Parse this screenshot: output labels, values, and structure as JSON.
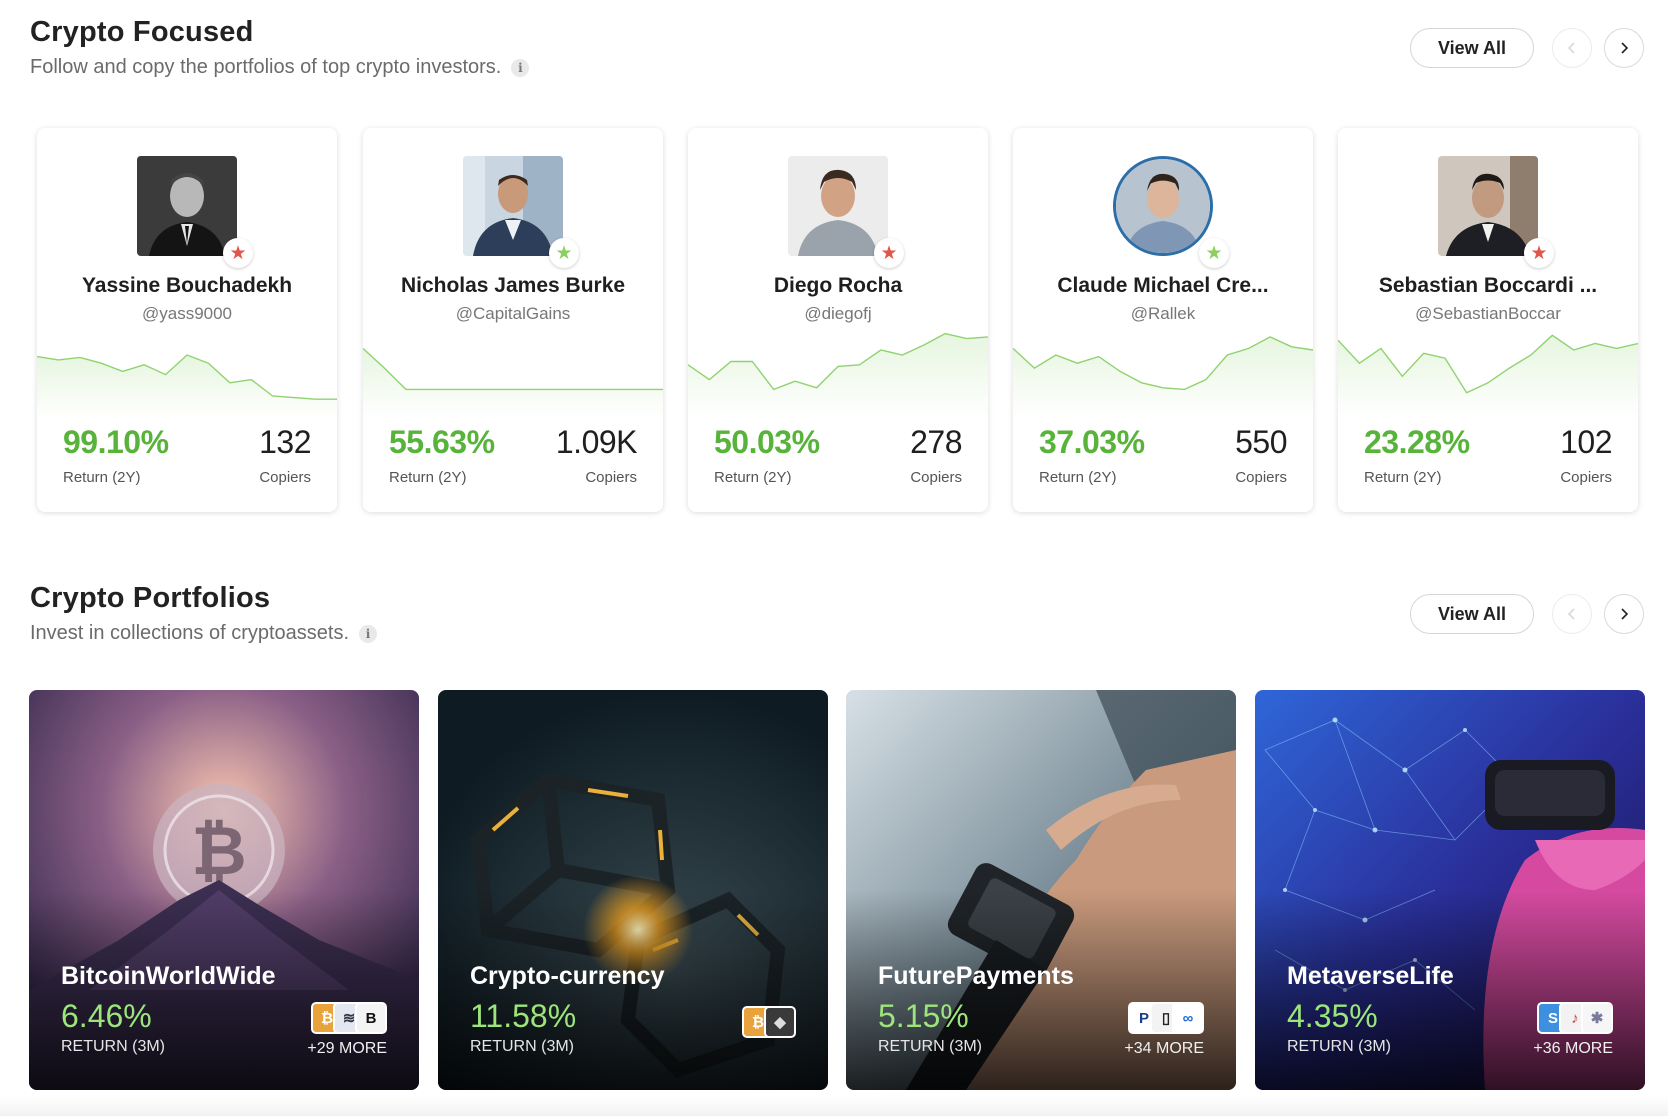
{
  "focused": {
    "title": "Crypto Focused",
    "subtitle": "Follow and copy the portfolios of top crypto investors.",
    "view_all": "View All",
    "investors": [
      {
        "name": "Yassine Bouchadekh",
        "handle": "@yass9000",
        "return": "99.10%",
        "return_label": "Return (2Y)",
        "copiers": "132",
        "copiers_label": "Copiers",
        "star": "red",
        "spark": [
          30,
          34,
          31,
          38,
          48,
          40,
          52,
          28,
          38,
          62,
          58,
          78,
          80,
          82,
          82
        ]
      },
      {
        "name": "Nicholas James Burke",
        "handle": "@CapitalGains",
        "return": "55.63%",
        "return_label": "Return (2Y)",
        "copiers": "1.09K",
        "copiers_label": "Copiers",
        "star": "green",
        "spark": [
          20,
          44,
          70,
          70,
          70,
          70,
          70,
          70,
          70,
          70,
          70,
          70,
          70,
          70,
          70
        ]
      },
      {
        "name": "Diego Rocha",
        "handle": "@diegofj",
        "return": "50.03%",
        "return_label": "Return (2Y)",
        "copiers": "278",
        "copiers_label": "Copiers",
        "star": "red",
        "spark": [
          40,
          58,
          36,
          36,
          70,
          60,
          68,
          42,
          40,
          22,
          28,
          16,
          2,
          8,
          6
        ]
      },
      {
        "name": "Claude Michael Cre...",
        "handle": "@Rallek",
        "return": "37.03%",
        "return_label": "Return (2Y)",
        "copiers": "550",
        "copiers_label": "Copiers",
        "star": "green",
        "spark": [
          20,
          44,
          28,
          38,
          30,
          48,
          62,
          68,
          70,
          58,
          28,
          20,
          6,
          18,
          22
        ]
      },
      {
        "name": "Sebastian Boccardi ...",
        "handle": "@SebastianBoccar",
        "return": "23.28%",
        "return_label": "Return (2Y)",
        "copiers": "102",
        "copiers_label": "Copiers",
        "star": "red",
        "spark": [
          10,
          38,
          20,
          54,
          26,
          32,
          74,
          62,
          44,
          28,
          4,
          22,
          14,
          20,
          14
        ]
      }
    ]
  },
  "portfolios": {
    "title": "Crypto Portfolios",
    "subtitle": "Invest in collections of cryptoassets.",
    "view_all": "View All",
    "items": [
      {
        "name": "BitcoinWorldWide",
        "return": "6.46%",
        "return_label": "RETURN (3M)",
        "more": "+29 MORE"
      },
      {
        "name": "Crypto-currency",
        "return": "11.58%",
        "return_label": "RETURN (3M)",
        "more": ""
      },
      {
        "name": "FuturePayments",
        "return": "5.15%",
        "return_label": "RETURN (3M)",
        "more": "+34 MORE"
      },
      {
        "name": "MetaverseLife",
        "return": "4.35%",
        "return_label": "RETURN (3M)",
        "more": "+36 MORE"
      }
    ]
  },
  "colors": {
    "positive": "#58b33a",
    "star_red": "#e0574a",
    "star_green": "#8ccf5e"
  },
  "icons": [
    "info-icon",
    "chevron-left-icon",
    "chevron-right-icon",
    "star-icon",
    "bitcoin-icon",
    "ethereum-icon",
    "paypal-icon"
  ]
}
